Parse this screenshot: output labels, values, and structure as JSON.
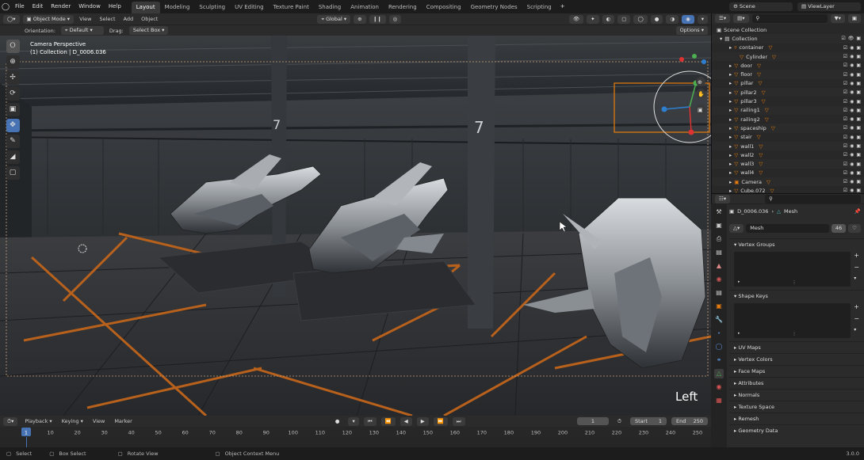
{
  "menu": [
    "File",
    "Edit",
    "Render",
    "Window",
    "Help"
  ],
  "workspaces": [
    "Layout",
    "Modeling",
    "Sculpting",
    "UV Editing",
    "Texture Paint",
    "Shading",
    "Animation",
    "Rendering",
    "Compositing",
    "Geometry Nodes",
    "Scripting"
  ],
  "active_workspace": "Layout",
  "scene": "Scene",
  "view_layer": "ViewLayer",
  "viewport_header": {
    "mode": "Object Mode",
    "view": "View",
    "select": "Select",
    "add": "Add",
    "object": "Object",
    "transform": "Global"
  },
  "tool_header": {
    "orientation_label": "Orientation:",
    "orientation": "Default",
    "drag_label": "Drag:",
    "drag": "Select Box",
    "options": "Options"
  },
  "viewport": {
    "perspective": "Camera Perspective",
    "collection": "(1) Collection | D_0006.036",
    "view_name": "Left",
    "label_7a": "7",
    "label_7b": "7"
  },
  "outliner": {
    "root": "Scene Collection",
    "collection": "Collection",
    "items": [
      {
        "name": "container",
        "indent": 2,
        "icon": "▿"
      },
      {
        "name": "Cylinder",
        "indent": 3,
        "icon": "▽"
      },
      {
        "name": "door",
        "indent": 2,
        "icon": "▽"
      },
      {
        "name": "floor",
        "indent": 2,
        "icon": "▽"
      },
      {
        "name": "pillar",
        "indent": 2,
        "icon": "▽"
      },
      {
        "name": "pillar2",
        "indent": 2,
        "icon": "▽"
      },
      {
        "name": "pillar3",
        "indent": 2,
        "icon": "▽"
      },
      {
        "name": "railing1",
        "indent": 2,
        "icon": "▽"
      },
      {
        "name": "railing2",
        "indent": 2,
        "icon": "▽"
      },
      {
        "name": "spaceship",
        "indent": 2,
        "icon": "▽"
      },
      {
        "name": "stair",
        "indent": 2,
        "icon": "▽"
      },
      {
        "name": "wall1",
        "indent": 2,
        "icon": "▽"
      },
      {
        "name": "wall2",
        "indent": 2,
        "icon": "▽"
      },
      {
        "name": "wall3",
        "indent": 2,
        "icon": "▽"
      },
      {
        "name": "wall4",
        "indent": 2,
        "icon": "▽"
      },
      {
        "name": "Camera",
        "indent": 2,
        "icon": "▣"
      },
      {
        "name": "Cube.072",
        "indent": 2,
        "icon": "▽"
      }
    ]
  },
  "properties": {
    "object": "D_0006.036",
    "data_type": "Mesh",
    "mesh_name": "Mesh",
    "users": "46",
    "panels_open": [
      "Vertex Groups",
      "Shape Keys"
    ],
    "panels_closed": [
      "UV Maps",
      "Vertex Colors",
      "Face Maps",
      "Attributes",
      "Normals",
      "Texture Space",
      "Remesh",
      "Geometry Data"
    ]
  },
  "timeline": {
    "menus": [
      "Playback",
      "Keying",
      "View",
      "Marker"
    ],
    "current_frame": "1",
    "start_label": "Start",
    "start": "1",
    "end_label": "End",
    "end": "250",
    "ticks": [
      "1",
      "10",
      "20",
      "30",
      "40",
      "50",
      "60",
      "70",
      "80",
      "90",
      "100",
      "110",
      "120",
      "130",
      "140",
      "150",
      "160",
      "170",
      "180",
      "190",
      "200",
      "210",
      "220",
      "230",
      "240",
      "250"
    ]
  },
  "status": {
    "select": "Select",
    "box_select": "Box Select",
    "rotate_view": "Rotate View",
    "context_menu": "Object Context Menu",
    "version": "3.0.0"
  },
  "colors": {
    "accent": "#4772b3",
    "orange": "#e87d0d",
    "header": "#2b2b2b"
  }
}
